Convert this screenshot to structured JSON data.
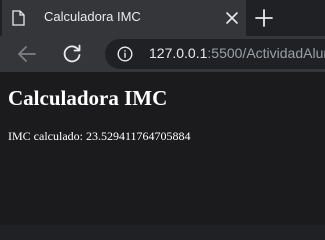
{
  "tab": {
    "title": "Calculadora IMC",
    "favicon": "document-icon",
    "close_icon": "close-icon"
  },
  "toolbar": {
    "back_icon": "arrow-left-icon",
    "reload_icon": "reload-icon",
    "new_tab_icon": "plus-icon",
    "info_icon": "info-icon"
  },
  "address_bar": {
    "host": "127.0.0.1",
    "rest": ":5500/ActividadAlum"
  },
  "page": {
    "heading": "Calculadora IMC",
    "result": "IMC calculado: 23.529411764705884"
  },
  "colors": {
    "tabstrip_bg": "#202124",
    "toolbar_bg": "#35363a",
    "page_bg": "#1b1b1d",
    "text": "#e8eaed",
    "muted_text": "#9aa0a6"
  }
}
